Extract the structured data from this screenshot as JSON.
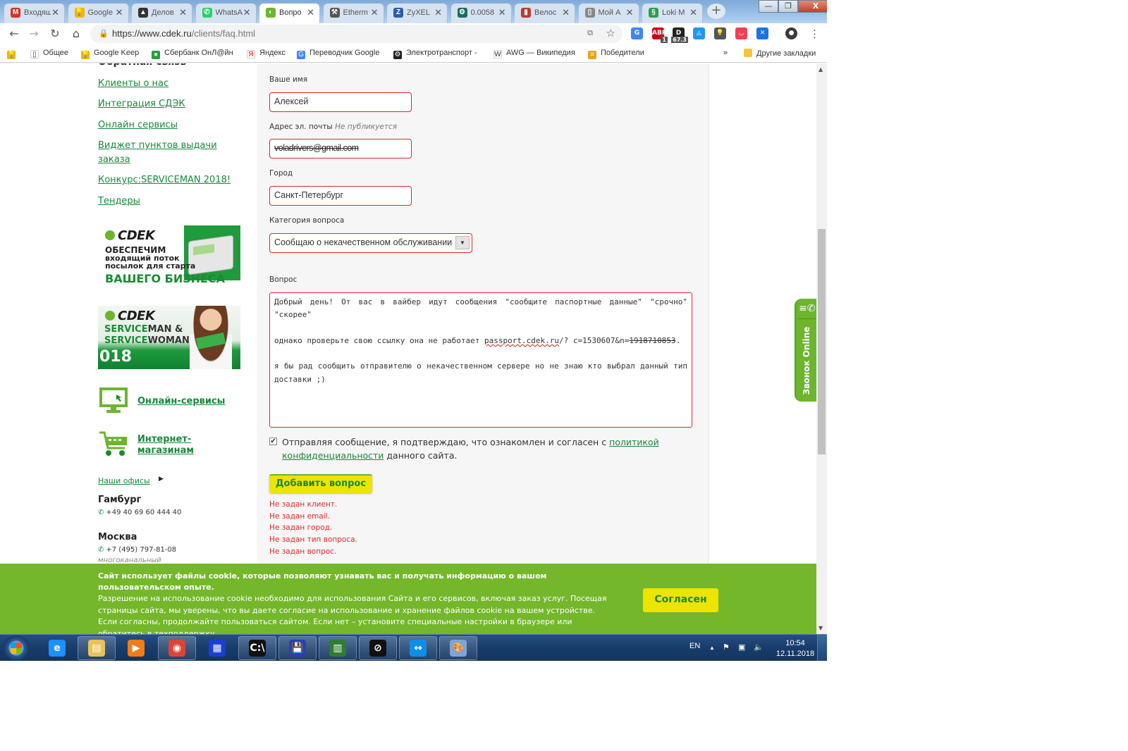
{
  "browser": {
    "tabs": [
      {
        "label": "Входящ",
        "icon": "gmail-icon",
        "color": "#d93025",
        "glyph": "M"
      },
      {
        "label": "Google",
        "icon": "google-keep-icon",
        "color": "#f4b400",
        "glyph": "💡"
      },
      {
        "label": "Делов",
        "icon": "delovye-icon",
        "color": "#333333",
        "glyph": "▲"
      },
      {
        "label": "WhatsA",
        "icon": "whatsapp-icon",
        "color": "#25d366",
        "glyph": "✆"
      },
      {
        "label": "Вопро",
        "icon": "cdek-icon",
        "color": "#6cb52d",
        "glyph": "◐",
        "active": true
      },
      {
        "label": "Etherm",
        "icon": "pickaxe-icon",
        "color": "#555555",
        "glyph": "⚒"
      },
      {
        "label": "ZyXEL",
        "icon": "zyxel-icon",
        "color": "#2a5caa",
        "glyph": "Z"
      },
      {
        "label": "0.0058",
        "icon": "crypto-icon",
        "color": "#1c6b5c",
        "glyph": "⚙"
      },
      {
        "label": "Велос",
        "icon": "velo-icon",
        "color": "#c0392b",
        "glyph": "▮"
      },
      {
        "label": "Мой А",
        "icon": "page-icon",
        "color": "#888888",
        "glyph": "▯"
      },
      {
        "label": "Loki M",
        "icon": "loki-icon",
        "color": "#2e9e4f",
        "glyph": "§"
      }
    ],
    "new_tab_label": "+",
    "window_controls": {
      "minimize": "—",
      "maximize": "❐",
      "close": "X"
    },
    "url_host": "https://www.cdek.ru",
    "url_path": "/clients/faq.html",
    "extensions": [
      {
        "name": "google-translate-ext-icon",
        "color": "#4285f4",
        "glyph": "G"
      },
      {
        "name": "adblock-ext-icon",
        "color": "#d0021b",
        "glyph": "ABP",
        "badge": "1"
      },
      {
        "name": "d-ext-icon",
        "color": "#222222",
        "glyph": "D",
        "badge": "67.3"
      },
      {
        "name": "vpn-ext-icon",
        "color": "#2196f3",
        "glyph": "◬"
      },
      {
        "name": "keep-ext-icon",
        "color": "#555555",
        "glyph": "💡"
      },
      {
        "name": "pocket-ext-icon",
        "color": "#ef4056",
        "glyph": "◡"
      },
      {
        "name": "x-ext-icon",
        "color": "#1a73e8",
        "glyph": "✕"
      },
      {
        "name": "profile-avatar-icon",
        "color": "#3a3a3a",
        "glyph": "●"
      }
    ],
    "bookmarks": [
      {
        "label": "",
        "icon": "keep-bookmark-icon",
        "color": "#f4b400",
        "glyph": "💡"
      },
      {
        "label": "Общее",
        "icon": "page-bookmark-icon",
        "color": "#ffffff",
        "glyph": "▯"
      },
      {
        "label": "Google Keep",
        "icon": "keep-bookmark-icon",
        "color": "#f4b400",
        "glyph": "💡"
      },
      {
        "label": "Сбербанк ОнЛ@йн",
        "icon": "sberbank-icon",
        "color": "#21a038",
        "glyph": "●"
      },
      {
        "label": "Яндекс",
        "icon": "yandex-icon",
        "color": "#ffffff",
        "glyph": "Я"
      },
      {
        "label": "Переводчик Google",
        "icon": "translate-bookmark-icon",
        "color": "#4285f4",
        "glyph": "G"
      },
      {
        "label": "Электротранспорт -",
        "icon": "wheel-icon",
        "color": "#222222",
        "glyph": "⚙"
      },
      {
        "label": "AWG — Википедия",
        "icon": "wikipedia-icon",
        "color": "#ffffff",
        "glyph": "W"
      },
      {
        "label": "Победители",
        "icon": "ribbon-icon",
        "color": "#e8a317",
        "glyph": "≡"
      }
    ],
    "bookmarks_overflow": "»",
    "other_bookmarks": "Другие закладки"
  },
  "sidebar": {
    "heading_partial": "Обратная связь",
    "links": [
      "Клиенты о нас",
      "Интеграция СДЭК",
      "Онлайн сервисы",
      "Виджет пунктов выдачи заказа",
      "Конкурс:SERVICEMAN 2018!",
      "Тендеры"
    ],
    "banner1": {
      "logo": "CDEK",
      "line1": "ОБЕСПЕЧИМ",
      "line2": "входящий поток посылок для старта",
      "line3": "ВАШЕГО БИЗНЕСА"
    },
    "banner2": {
      "logo": "CDEK",
      "line1a": "SERVICE",
      "line1b": "MAN &",
      "line2a": "SERVICE",
      "line2b": "WOMAN",
      "year": "018"
    },
    "promo_online": "Онлайн-сервисы",
    "promo_shops": "Интернет-магазинам",
    "offices_link": "Наши офисы",
    "offices": [
      {
        "city": "Гамбург",
        "phone": "+49 40 69 60 444 40"
      },
      {
        "city": "Москва",
        "phone": "+7 (495) 797-81-08",
        "note": "многоканальный"
      }
    ]
  },
  "form": {
    "name_label": "Ваше имя",
    "name_value": "Алексей",
    "email_label": "Адрес эл. почты",
    "email_hint": "Не публикуется",
    "email_value": "voladrivers@gmail.com",
    "city_label": "Город",
    "city_value": "Санкт-Петербург",
    "category_label": "Категория вопроса",
    "category_value": "Сообщаю о некачественном обслуживании",
    "question_label": "Вопрос",
    "question_p1": "Добрый день! От вас в вайбер идут сообщения \"сообщите паспортные данные\" \"срочно\" \"скорее\"",
    "question_p2_pre": "однако проверьте свою ссылку она не работает ",
    "question_p2_link": "passport.cdek.ru",
    "question_p2_mid": "/? c=1530607&n=",
    "question_p2_redacted": "1918710853",
    "question_p2_end": ".",
    "question_p3": "я бы рад сообщить отправителю о некачественном сервере но не знаю кто выбрал данный тип доставки ;)",
    "consent_checked": true,
    "consent_pre": "Отправляя сообщение, я подтверждаю, что ознакомлен и согласен с ",
    "consent_link": "политикой конфиденциальности",
    "consent_post": " данного сайта.",
    "submit_label": "Добавить вопрос",
    "errors": [
      "Не задан клиент.",
      "Не задан email.",
      "Не задан город.",
      "Не задан тип вопроса.",
      "Не задан вопрос."
    ]
  },
  "call_widget": {
    "label": "Звонок Online"
  },
  "cookie_banner": {
    "title": "Сайт использует файлы cookie, которые позволяют узнавать вас и получать информацию о вашем пользовательском опыте.",
    "body": "Разрешение на использование cookie необходимо для использования Сайта и его сервисов, включая заказ услуг. Посещая страницы сайта, мы уверены, что вы даете согласие на использование и хранение файлов cookie на вашем устройстве. Если согласны, продолжайте пользоваться сайтом. Если нет – установите специальные настройки в браузере или обратитесь в техподдержку.",
    "agree_label": "Согласен"
  },
  "taskbar": {
    "items": [
      {
        "name": "internet-explorer-icon",
        "glyph": "e",
        "color": "#1e90ff",
        "pinned": false
      },
      {
        "name": "file-explorer-icon",
        "glyph": "▤",
        "color": "#e8c25a",
        "pinned": true
      },
      {
        "name": "media-player-icon",
        "glyph": "▶",
        "color": "#f07c1a",
        "pinned": false
      },
      {
        "name": "chrome-icon",
        "glyph": "◉",
        "color": "#db4437",
        "pinned": true
      },
      {
        "name": "city-app-icon",
        "glyph": "▦",
        "color": "#1a3fd4",
        "pinned": false
      },
      {
        "name": "command-prompt-icon",
        "glyph": "C:\\",
        "color": "#111111",
        "pinned": true
      },
      {
        "name": "save-app-icon",
        "glyph": "💾",
        "color": "#2b3fb0",
        "pinned": true
      },
      {
        "name": "task-manager-icon",
        "glyph": "▥",
        "color": "#2e7d32",
        "pinned": true
      },
      {
        "name": "no-signal-app-icon",
        "glyph": "⊘",
        "color": "#111111",
        "pinned": true
      },
      {
        "name": "teamviewer-icon",
        "glyph": "↔",
        "color": "#0e8ee9",
        "pinned": true
      },
      {
        "name": "paint-icon",
        "glyph": "🎨",
        "color": "#7aa6d8",
        "pinned": true
      }
    ],
    "language": "EN",
    "time": "10:54",
    "date": "12.11.2018"
  }
}
